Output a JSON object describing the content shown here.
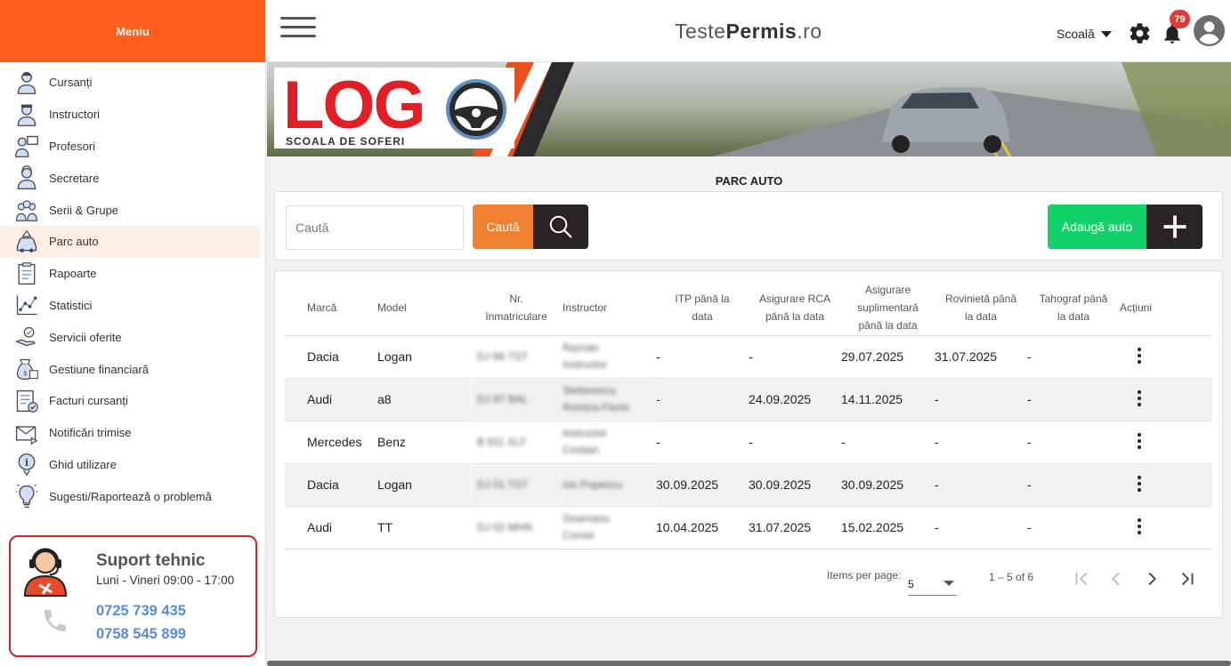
{
  "sidebar": {
    "title": "Meniu",
    "items": [
      {
        "label": "Cursanți",
        "icon": "student-icon"
      },
      {
        "label": "Instructori",
        "icon": "instructor-icon"
      },
      {
        "label": "Profesori",
        "icon": "teacher-icon"
      },
      {
        "label": "Secretare",
        "icon": "secretary-icon"
      },
      {
        "label": "Serii & Grupe",
        "icon": "group-icon"
      },
      {
        "label": "Parc auto",
        "icon": "car-icon",
        "active": true
      },
      {
        "label": "Rapoarte",
        "icon": "report-icon"
      },
      {
        "label": "Statistici",
        "icon": "statistics-icon"
      },
      {
        "label": "Servicii oferite",
        "icon": "service-icon"
      },
      {
        "label": "Gestiune financiară",
        "icon": "money-bag-icon"
      },
      {
        "label": "Facturi cursanți",
        "icon": "invoice-icon"
      },
      {
        "label": "Notificări trimise",
        "icon": "mail-icon"
      },
      {
        "label": "Ghid utilizare",
        "icon": "info-icon"
      },
      {
        "label": "Sugesti/Raportează o problemă",
        "icon": "lightbulb-icon"
      }
    ]
  },
  "support": {
    "title": "Suport tehnic",
    "hours": "Luni - Vineri 09:00 - 17:00",
    "phones": [
      "0725 739 435",
      "0758 545 899"
    ]
  },
  "topbar": {
    "brand_light": "Teste",
    "brand_bold": "Permis",
    "brand_suffix": ".ro",
    "school_label": "Scoală",
    "notifications": "79"
  },
  "banner": {
    "logo_text": "LOG",
    "logo_sub": "SCOALA DE SOFERI"
  },
  "page": {
    "title": "PARC AUTO",
    "search_placeholder": "Caută",
    "search_button": "Caută",
    "add_button": "Adaugă auto"
  },
  "table": {
    "headers": [
      "Marcă",
      "Model",
      "Nr. înmatriculare",
      "Instructor",
      "ITP până la data",
      "Asigurare RCA până la data",
      "Asigurare suplimentară până la data",
      "Rovinietă până la data",
      "Tahograf până la data",
      "Acțiuni"
    ],
    "rows": [
      {
        "marca": "Dacia",
        "model": "Logan",
        "nr": "DJ 66 TST",
        "instructor": "Razvan Instructor",
        "itp": "-",
        "rca": "-",
        "supl": "29.07.2025",
        "rov": "31.07.2025",
        "taho": "-"
      },
      {
        "marca": "Audi",
        "model": "a8",
        "nr": "DJ 97 BAL",
        "instructor": "Stefanescu Romica-Florin",
        "itp": "-",
        "rca": "24.09.2025",
        "supl": "14.11.2025",
        "rov": "-",
        "taho": "-"
      },
      {
        "marca": "Mercedes",
        "model": "Benz",
        "nr": "B 911 XLF",
        "instructor": "Instructor Cristian",
        "itp": "-",
        "rca": "-",
        "supl": "-",
        "rov": "-",
        "taho": "-"
      },
      {
        "marca": "Dacia",
        "model": "Logan",
        "nr": "DJ 01 TST",
        "instructor": "Ion Popescu",
        "itp": "30.09.2025",
        "rca": "30.09.2025",
        "supl": "30.09.2025",
        "rov": "-",
        "taho": "-"
      },
      {
        "marca": "Audi",
        "model": "TT",
        "nr": "DJ 02 MHN",
        "instructor": "Gearnanu Cornel",
        "itp": "10.04.2025",
        "rca": "31.07.2025",
        "supl": "15.02.2025",
        "rov": "-",
        "taho": "-"
      }
    ]
  },
  "pagination": {
    "items_per_page_label": "Items per page:",
    "items_per_page": "5",
    "range": "1 – 5 of 6"
  },
  "colors": {
    "accent": "#fe5f1e",
    "search": "#f08132",
    "add": "#12d36b",
    "dark": "#282426",
    "support_border": "#c62828",
    "phone": "#5b8bd1"
  }
}
